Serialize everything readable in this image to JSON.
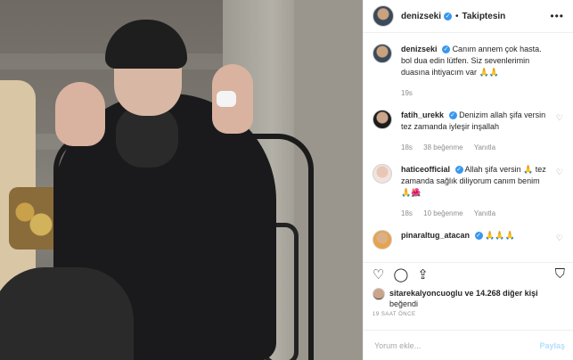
{
  "header": {
    "username": "denizseki",
    "verified_mark": "✓",
    "separator": "•",
    "follow_label": "Takiptesin",
    "more_icon": "more-horizontal-icon"
  },
  "caption": {
    "username": "denizseki",
    "text": "Canım annem çok hasta. bol dua edin lütfen. Siz sevenlerimin duasına ihtiyacım var 🙏🙏",
    "time": "19s"
  },
  "comments": [
    {
      "username": "fatih_urekk",
      "text": "Denizim allah şifa versin tez zamanda iyleşir inşallah",
      "time": "18s",
      "likes": "38 beğenme",
      "reply": "Yanıtla"
    },
    {
      "username": "haticeofficial",
      "text": "Allah şifa versin 🙏 tez zamanda sağlık diliyorum canım benim 🙏🌺",
      "time": "18s",
      "likes": "10 beğenme",
      "reply": "Yanıtla"
    },
    {
      "username": "pinaraltug_atacan",
      "text": "🙏🙏🙏"
    }
  ],
  "likes": {
    "user": "sitarekalyoncuoglu",
    "rest": "ve 14.268 diğer kişi",
    "suffix": "beğendi"
  },
  "post_time": "19 SAAT ÖNCE",
  "add_comment": {
    "placeholder": "Yorum ekle...",
    "post_label": "Paylaş"
  },
  "colors": {
    "link_blue": "#3897f0",
    "muted": "#8e8e8e",
    "post_btn": "#b2dffc"
  }
}
